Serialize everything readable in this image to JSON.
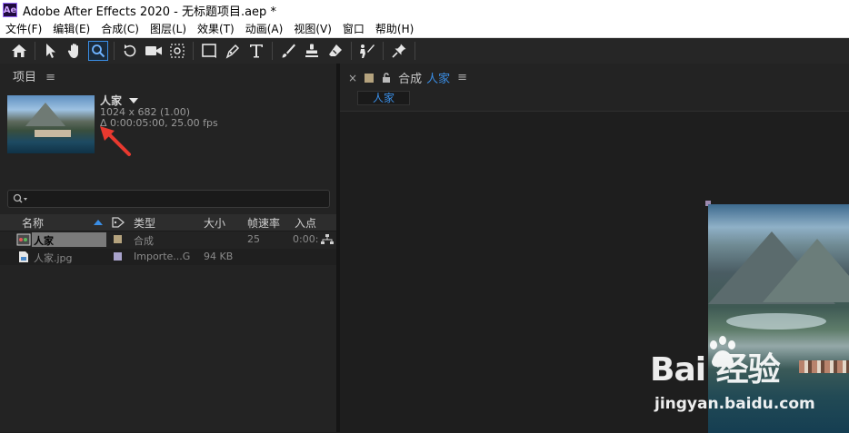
{
  "window": {
    "title": "Adobe After Effects 2020 - 无标题项目.aep *"
  },
  "menu": [
    "文件(F)",
    "编辑(E)",
    "合成(C)",
    "图层(L)",
    "效果(T)",
    "动画(A)",
    "视图(V)",
    "窗口",
    "帮助(H)"
  ],
  "project": {
    "tab_label": "项目",
    "asset": {
      "name": "人家",
      "dimensions": "1024 x 682 (1.00)",
      "duration": "Δ 0:00:05:00, 25.00 fps"
    },
    "columns": {
      "name": "名称",
      "type": "类型",
      "size": "大小",
      "fps": "帧速率",
      "in": "入点"
    },
    "items": [
      {
        "name": "人家",
        "type": "合成",
        "size": "",
        "fps": "25",
        "in": "0:00:",
        "label_color": "#b5a37e",
        "selected": true
      },
      {
        "name": "人家.jpg",
        "type": "Importe...G",
        "size": "94 KB",
        "fps": "",
        "in": "",
        "label_color": "#a9a3cc",
        "selected": false
      }
    ]
  },
  "composition": {
    "close_glyph": "×",
    "tab_prefix": "合成",
    "tab_name": "人家",
    "viewer_tab": "人家"
  },
  "watermark": {
    "brand": "Bai 经验",
    "site": "jingyan.baidu.com"
  },
  "colors": {
    "accent": "#3a8ee6",
    "comp_label": "#b5a37e",
    "footage_label": "#a9a3cc"
  }
}
